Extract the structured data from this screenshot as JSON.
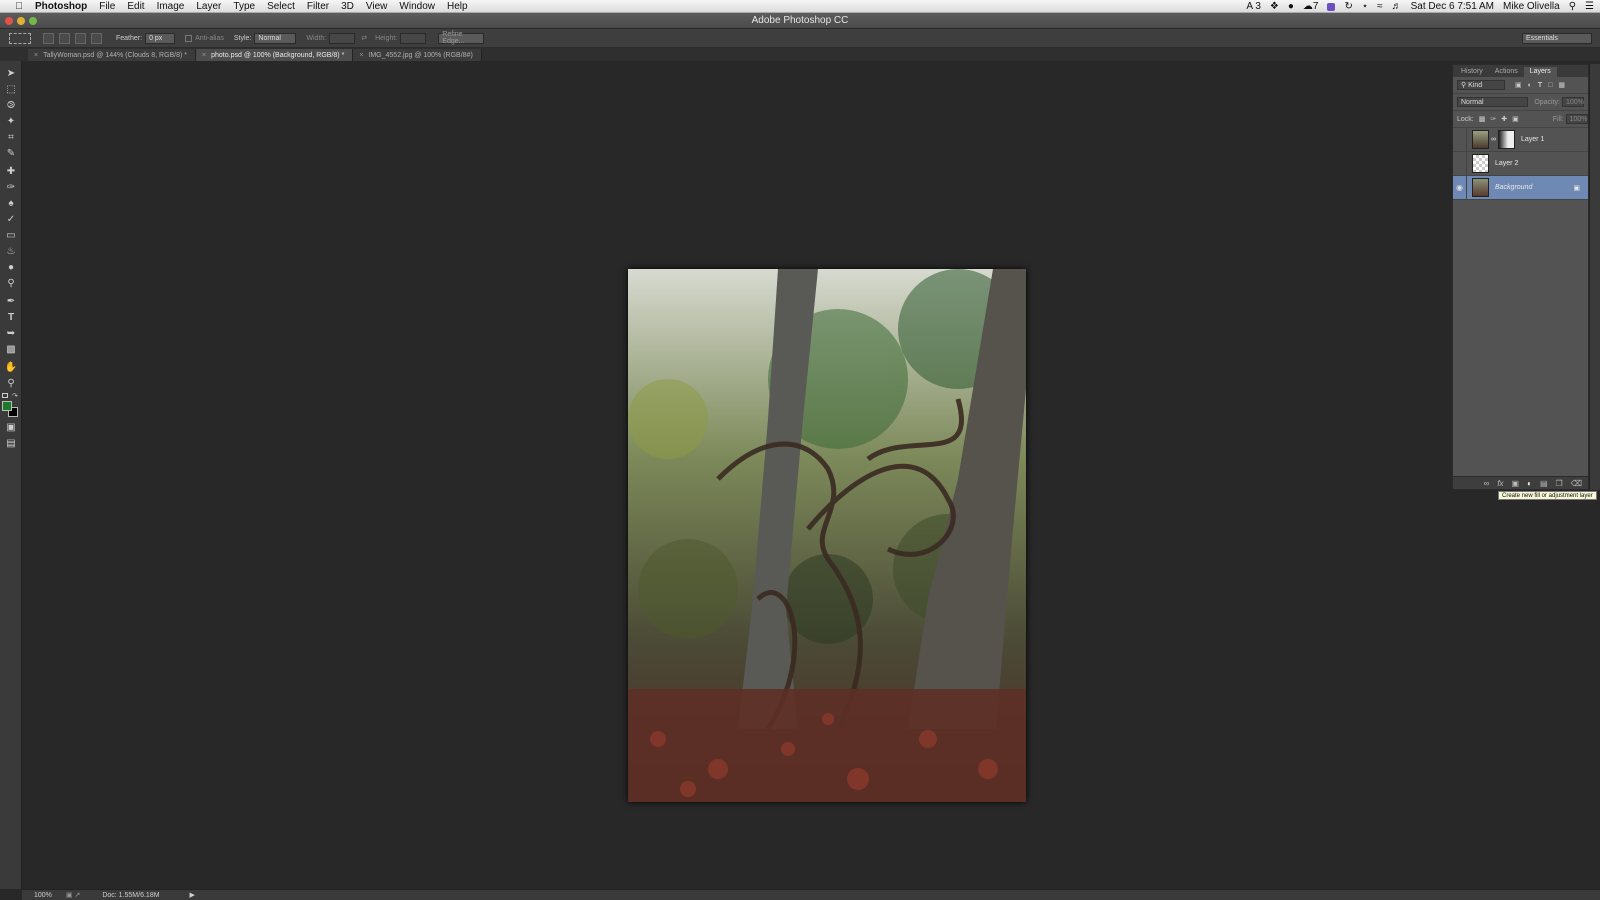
{
  "menubar": {
    "app_name": "Photoshop",
    "items": [
      "File",
      "Edit",
      "Image",
      "Layer",
      "Type",
      "Select",
      "Filter",
      "3D",
      "View",
      "Window",
      "Help"
    ],
    "status": {
      "adobe_count": "3",
      "creative_count": "7",
      "datetime": "Sat Dec 6  7:51 AM",
      "user": "Mike Olivella"
    }
  },
  "window": {
    "title": "Adobe Photoshop CC"
  },
  "options": {
    "feather_label": "Feather:",
    "feather_value": "0 px",
    "antialias_label": "Anti-alias",
    "style_label": "Style:",
    "style_value": "Normal",
    "width_label": "Width:",
    "height_label": "Height:",
    "refine_label": "Refine Edge...",
    "workspace": "Essentials"
  },
  "tabs": [
    {
      "label": "TallyWoman.psd @ 144% (Clouds 8, RGB/8) *"
    },
    {
      "label": "photo.psd @ 100% (Background, RGB/8) *"
    },
    {
      "label": "IMG_4552.jpg @ 100% (RGB/8#)"
    }
  ],
  "status_bar": {
    "zoom": "100%",
    "doc": "Doc: 1.55M/6.18M"
  },
  "panel": {
    "tabs": [
      "History",
      "Actions",
      "Layers"
    ],
    "kind_label": "Kind",
    "blend_mode": "Normal",
    "opacity_label": "Opacity:",
    "opacity_value": "100%",
    "lock_label": "Lock:",
    "fill_label": "Fill:",
    "fill_value": "100%",
    "layers": [
      {
        "name": "Layer 1"
      },
      {
        "name": "Layer 2"
      },
      {
        "name": "Background"
      }
    ],
    "tooltip": "Create new fill or adjustment layer"
  },
  "colors": {
    "foreground": "#1d7a2a",
    "background": "#000000",
    "selected_layer": "#6d89b4"
  }
}
